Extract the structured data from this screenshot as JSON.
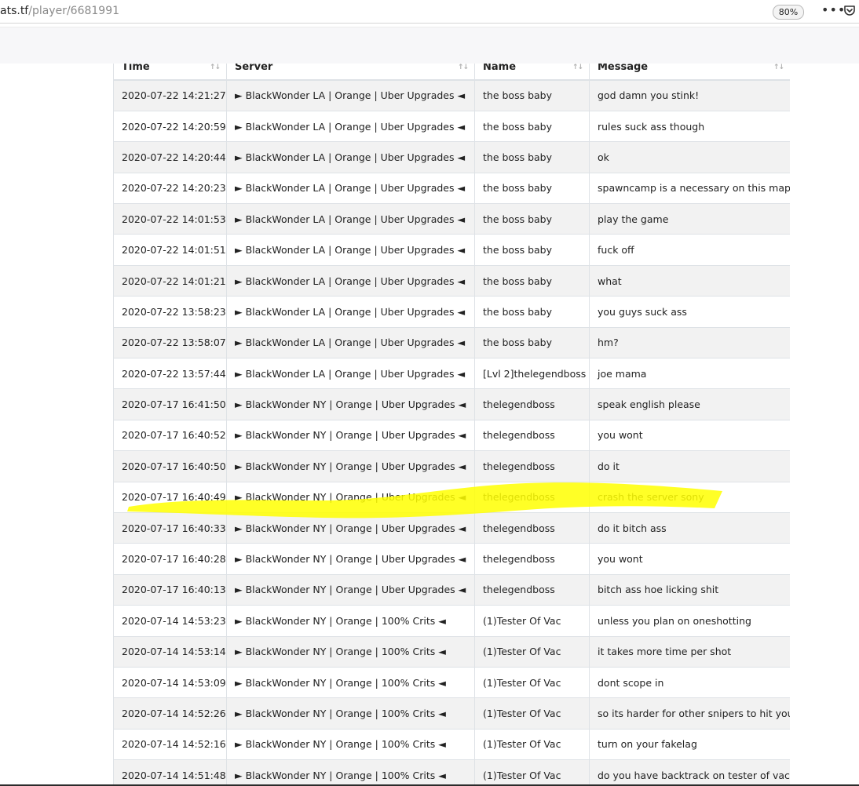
{
  "browser": {
    "url_host": "ats.tf",
    "url_path": "/player/6681991",
    "zoom": "80%",
    "menu_icon": "more-dots-icon",
    "pocket_icon": "pocket-icon"
  },
  "table": {
    "headers": [
      "Time",
      "Server",
      "Name",
      "Message"
    ],
    "rows": [
      {
        "time": "2020-07-22 14:21:27",
        "server": "► BlackWonder LA | Orange | Uber Upgrades ◄",
        "name": "the boss baby",
        "message": "god damn you stink!"
      },
      {
        "time": "2020-07-22 14:20:59",
        "server": "► BlackWonder LA | Orange | Uber Upgrades ◄",
        "name": "the boss baby",
        "message": "rules suck ass though"
      },
      {
        "time": "2020-07-22 14:20:44",
        "server": "► BlackWonder LA | Orange | Uber Upgrades ◄",
        "name": "the boss baby",
        "message": "ok"
      },
      {
        "time": "2020-07-22 14:20:23",
        "server": "► BlackWonder LA | Orange | Uber Upgrades ◄",
        "name": "the boss baby",
        "message": "spawncamp is a necessary on this map"
      },
      {
        "time": "2020-07-22 14:01:53",
        "server": "► BlackWonder LA | Orange | Uber Upgrades ◄",
        "name": "the boss baby",
        "message": "play the game"
      },
      {
        "time": "2020-07-22 14:01:51",
        "server": "► BlackWonder LA | Orange | Uber Upgrades ◄",
        "name": "the boss baby",
        "message": "fuck off"
      },
      {
        "time": "2020-07-22 14:01:21",
        "server": "► BlackWonder LA | Orange | Uber Upgrades ◄",
        "name": "the boss baby",
        "message": "what"
      },
      {
        "time": "2020-07-22 13:58:23",
        "server": "► BlackWonder LA | Orange | Uber Upgrades ◄",
        "name": "the boss baby",
        "message": "you guys suck ass"
      },
      {
        "time": "2020-07-22 13:58:07",
        "server": "► BlackWonder LA | Orange | Uber Upgrades ◄",
        "name": "the boss baby",
        "message": "hm?"
      },
      {
        "time": "2020-07-22 13:57:44",
        "server": "► BlackWonder LA | Orange | Uber Upgrades ◄",
        "name": "[Lvl 2]thelegendboss",
        "message": "joe mama"
      },
      {
        "time": "2020-07-17 16:41:50",
        "server": "► BlackWonder NY | Orange | Uber Upgrades ◄",
        "name": "thelegendboss",
        "message": "speak english please"
      },
      {
        "time": "2020-07-17 16:40:52",
        "server": "► BlackWonder NY | Orange | Uber Upgrades ◄",
        "name": "thelegendboss",
        "message": "you wont"
      },
      {
        "time": "2020-07-17 16:40:50",
        "server": "► BlackWonder NY | Orange | Uber Upgrades ◄",
        "name": "thelegendboss",
        "message": "do it"
      },
      {
        "time": "2020-07-17 16:40:49",
        "server": "► BlackWonder NY | Orange | Uber Upgrades ◄",
        "name": "thelegendboss",
        "message": "crash the server sony"
      },
      {
        "time": "2020-07-17 16:40:33",
        "server": "► BlackWonder NY | Orange | Uber Upgrades ◄",
        "name": "thelegendboss",
        "message": "do it bitch ass"
      },
      {
        "time": "2020-07-17 16:40:28",
        "server": "► BlackWonder NY | Orange | Uber Upgrades ◄",
        "name": "thelegendboss",
        "message": "you wont"
      },
      {
        "time": "2020-07-17 16:40:13",
        "server": "► BlackWonder NY | Orange | Uber Upgrades ◄",
        "name": "thelegendboss",
        "message": "bitch ass hoe licking shit"
      },
      {
        "time": "2020-07-14 14:53:23",
        "server": "► BlackWonder NY | Orange | 100% Crits ◄",
        "name": "(1)Tester Of Vac",
        "message": "unless you plan on oneshotting"
      },
      {
        "time": "2020-07-14 14:53:14",
        "server": "► BlackWonder NY | Orange | 100% Crits ◄",
        "name": "(1)Tester Of Vac",
        "message": "it takes more time per shot"
      },
      {
        "time": "2020-07-14 14:53:09",
        "server": "► BlackWonder NY | Orange | 100% Crits ◄",
        "name": "(1)Tester Of Vac",
        "message": "dont scope in"
      },
      {
        "time": "2020-07-14 14:52:26",
        "server": "► BlackWonder NY | Orange | 100% Crits ◄",
        "name": "(1)Tester Of Vac",
        "message": "so its harder for other snipers to hit you"
      },
      {
        "time": "2020-07-14 14:52:16",
        "server": "► BlackWonder NY | Orange | 100% Crits ◄",
        "name": "(1)Tester Of Vac",
        "message": "turn on your fakelag"
      },
      {
        "time": "2020-07-14 14:51:48",
        "server": "► BlackWonder NY | Orange | 100% Crits ◄",
        "name": "(1)Tester Of Vac",
        "message": "do you have backtrack on tester of vac"
      }
    ]
  },
  "annotation": {
    "color": "#ffff00",
    "highlighted_row_index": 13
  }
}
